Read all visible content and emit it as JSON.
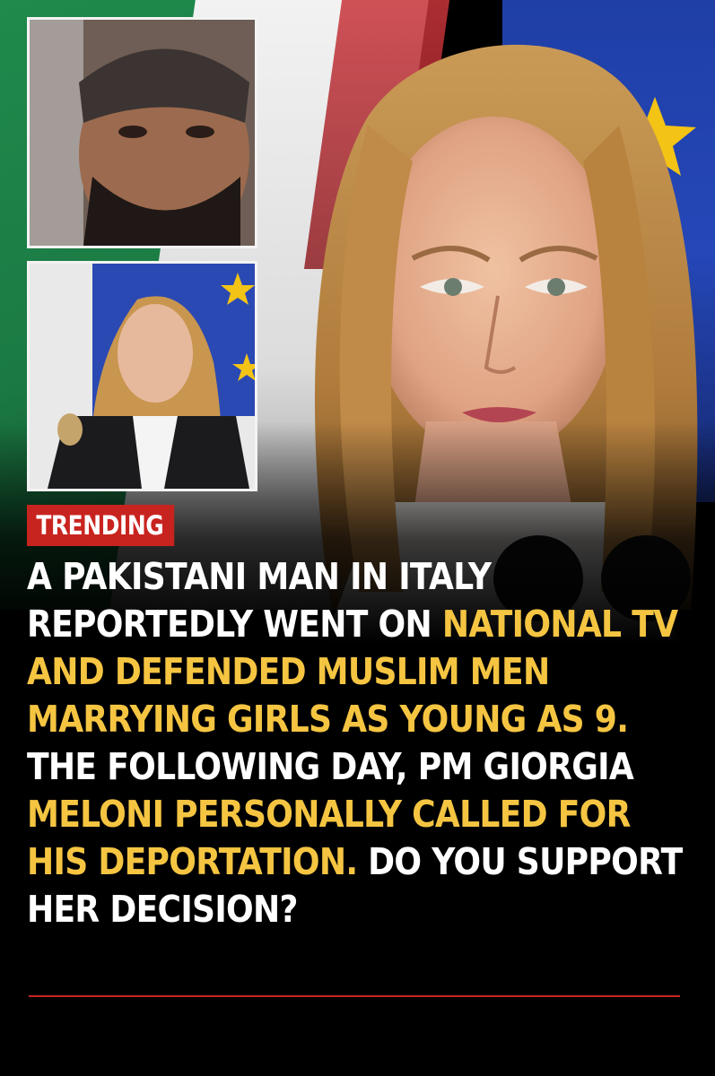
{
  "badge": {
    "label": "TRENDING"
  },
  "headline": {
    "segments": [
      {
        "text": "A PAKISTANI MAN IN ITALY REPORTEDLY WENT ON ",
        "color": "white"
      },
      {
        "text": "NATIONAL TV AND DEFENDED MUSLIM MEN MARRYING GIRLS AS YOUNG AS 9.",
        "color": "yellow"
      },
      {
        "text": " THE FOLLOWING DAY, PM GIORGIA ",
        "color": "white"
      },
      {
        "text": "MELONI PERSONALLY CALLED FOR HIS DEPORTATION.",
        "color": "yellow"
      },
      {
        "text": " DO YOU SUPPORT HER DECISION?",
        "color": "white"
      }
    ]
  },
  "colors": {
    "badge_bg": "#c8241f",
    "highlight_text": "#f5c542",
    "body_text": "#ffffff",
    "background": "#000000"
  }
}
